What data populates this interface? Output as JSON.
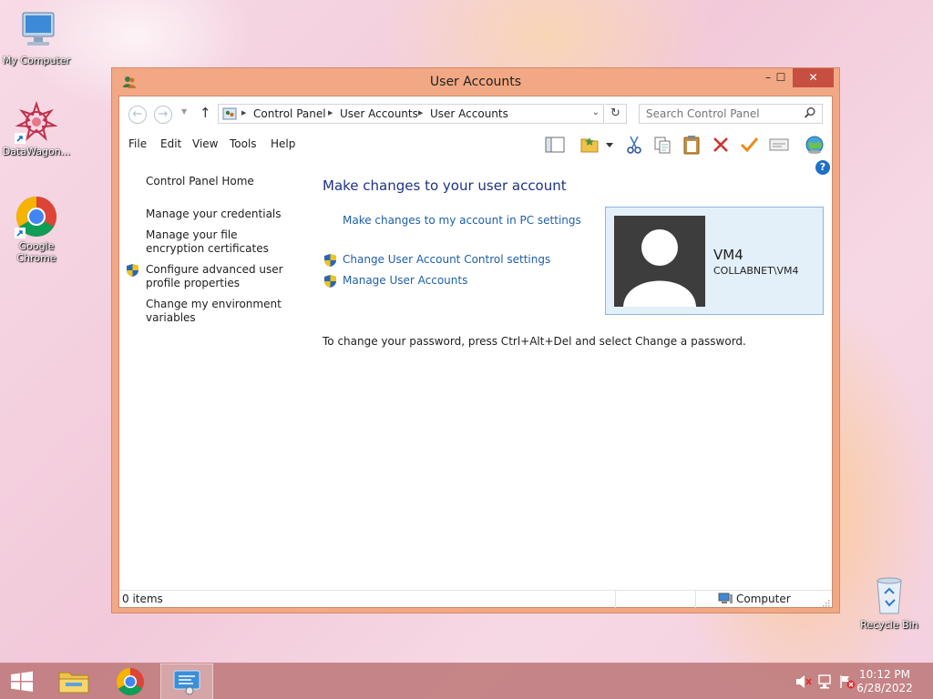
{
  "desktop": {
    "icons": [
      {
        "label": "My Computer",
        "icon": "computer-icon"
      },
      {
        "label": "DataWagon...",
        "icon": "datawagon-icon"
      },
      {
        "label": "Google Chrome",
        "icon": "chrome-icon"
      },
      {
        "label": "Recycle Bin",
        "icon": "recycle-bin-icon"
      }
    ]
  },
  "window": {
    "title": "User Accounts",
    "controls": {
      "minimize": "–",
      "maximize": "☐",
      "close": "✕"
    }
  },
  "navigation": {
    "back": "←",
    "forward": "→",
    "up": "↑",
    "breadcrumbs": [
      "Control Panel",
      "User Accounts",
      "User Accounts"
    ],
    "search_placeholder": "Search Control Panel"
  },
  "menu": {
    "items": [
      "File",
      "Edit",
      "View",
      "Tools",
      "Help"
    ]
  },
  "toolbar": {
    "icons": [
      "layout-icon",
      "favorites-folder-icon",
      "dropdown-icon",
      "cut-icon",
      "copy-icon",
      "paste-icon",
      "delete-icon",
      "checkmark-icon",
      "properties-icon",
      "globe-icon"
    ]
  },
  "left_pane": {
    "home": "Control Panel Home",
    "links": [
      "Manage your credentials",
      "Manage your file encryption certificates",
      "Configure advanced user profile properties",
      "Change my environment variables"
    ]
  },
  "main": {
    "title": "Make changes to your user account",
    "pc_settings_link": "Make changes to my account in PC settings",
    "uac_link": "Change User Account Control settings",
    "manage_link": "Manage User Accounts",
    "password_info": "To change your password, press Ctrl+Alt+Del and select Change a password."
  },
  "account": {
    "name": "VM4",
    "domain": "COLLABNET\\VM4"
  },
  "status": {
    "items": "0 items",
    "zone": "Computer"
  },
  "taskbar": {
    "time": "10:12 PM",
    "date": "6/28/2022"
  },
  "colors": {
    "window_frame": "#f2a884",
    "close_button": "#c74f41",
    "link": "#1e5fa8",
    "heading": "#1e3287",
    "tile_background": "#e3f0fa",
    "taskbar": "#b76e6e"
  }
}
